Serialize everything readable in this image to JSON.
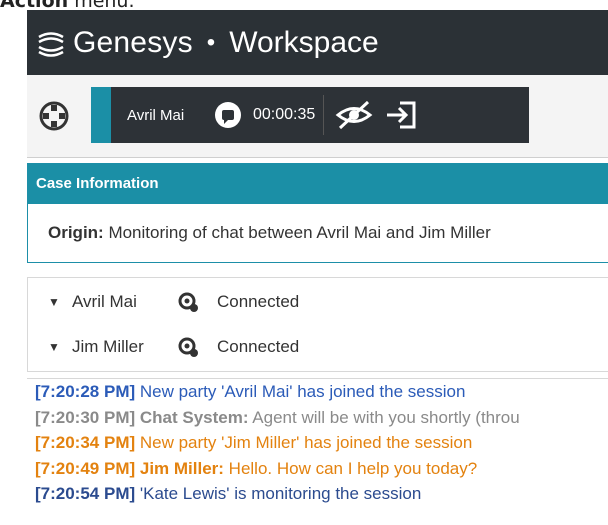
{
  "caption": {
    "bold": "Action",
    "rest": " menu."
  },
  "app": {
    "brand": "Genesys",
    "separator": "•",
    "product": "Workspace"
  },
  "call_bar": {
    "party_name": "Avril Mai",
    "timer": "00:00:35"
  },
  "case_info": {
    "header": "Case Information",
    "origin_label": "Origin:",
    "origin_value": " Monitoring of chat between Avril Mai and Jim Miller"
  },
  "parties": [
    {
      "name": "Avril Mai",
      "status": "Connected"
    },
    {
      "name": "Jim Miller",
      "status": "Connected"
    }
  ],
  "transcript": [
    {
      "time": "[7:20:28 PM]",
      "speaker": "",
      "text": " New party 'Avril Mai' has joined the session",
      "color": "#2b5bb8"
    },
    {
      "time": "[7:20:30 PM]",
      "speaker": " Chat System:",
      "text": " Agent will be with you shortly (throu",
      "color": "#8a8a8a"
    },
    {
      "time": "[7:20:34 PM]",
      "speaker": "",
      "text": " New party 'Jim Miller' has joined the session",
      "color": "#e3820f"
    },
    {
      "time": "[7:20:49 PM]",
      "speaker": " Jim Miller:",
      "text": " Hello. How can I help you today?",
      "color": "#e3820f"
    },
    {
      "time": "[7:20:54 PM]",
      "speaker": "",
      "text": " 'Kate Lewis' is monitoring the session",
      "color": "#2b4b8f"
    }
  ],
  "colors": {
    "titlebar": "#2b3136",
    "accent_teal": "#1b8fa6",
    "call_bar": "#2d3237"
  },
  "icons": {
    "logo": "genesys-logo-icon",
    "toolbar": "target-icon",
    "chat": "chat-bubble-icon",
    "stop_monitor": "eye-slash-icon",
    "exit": "exit-icon",
    "status": "status-icon"
  }
}
